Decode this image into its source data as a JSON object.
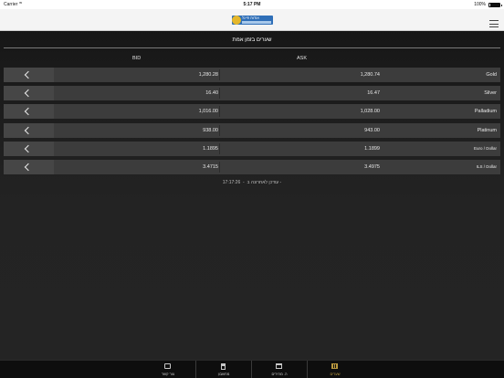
{
  "status_bar": {
    "carrier": "Carrier",
    "wifi_icon": "wifi-icon",
    "time": "5:17 PM",
    "battery": "100%"
  },
  "nav": {
    "logo_text": "אודות פיינל",
    "menu_icon": "hamburger-menu-icon"
  },
  "page": {
    "title": "שערים בזמן אמת",
    "bid_header": "BID",
    "ask_header": "ASK"
  },
  "rates": [
    {
      "name": "Gold",
      "bid": "1,280.28",
      "ask": "1,280.74"
    },
    {
      "name": "Silver",
      "bid": "16.40",
      "ask": "16.47"
    },
    {
      "name": "Palladium",
      "bid": "1,016.00",
      "ask": "1,028.00"
    },
    {
      "name": "Platinum",
      "bid": "938.00",
      "ask": "943.00"
    },
    {
      "name": "Euro / Dollar",
      "bid": "1.1895",
      "ask": "1.1899"
    },
    {
      "name": "ILS / Dollar",
      "bid": "3.4715",
      "ask": "3.4975"
    }
  ],
  "update": {
    "time": "17:17:26",
    "label": "עודכן לאחרונה ב -"
  },
  "tabs": [
    {
      "label": "צור קשר",
      "icon": "envelope-icon"
    },
    {
      "label": "מחשבון",
      "icon": "calculator-icon"
    },
    {
      "label": "ה. מחירים",
      "icon": "calendar-icon"
    },
    {
      "label": "שערים",
      "icon": "gold-bars-icon"
    }
  ],
  "colors": {
    "accent_gold": "#b8973e",
    "row_bg": "#3c3c3c",
    "logo_blue": "#2f6fb8"
  }
}
